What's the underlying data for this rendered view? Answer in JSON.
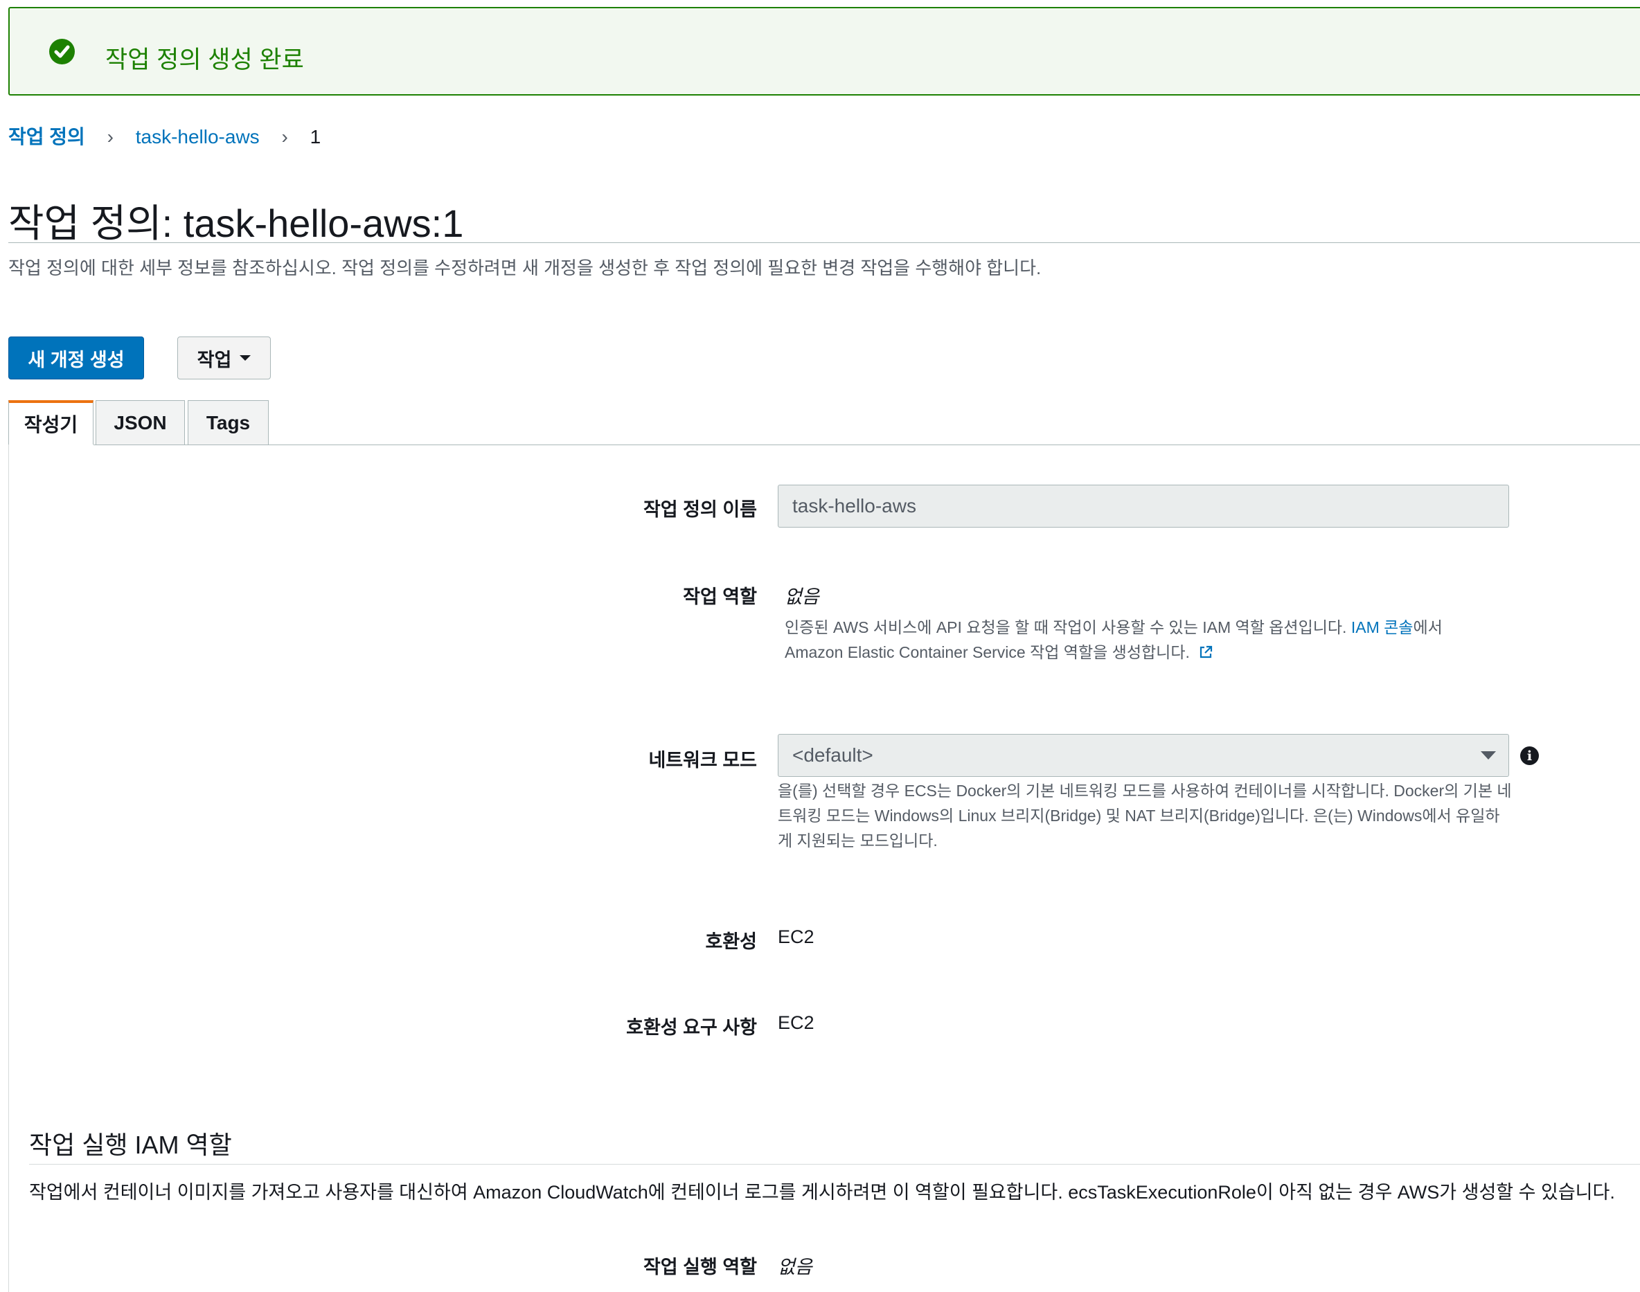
{
  "flash": {
    "message": "작업 정의 생성 완료"
  },
  "breadcrumb": {
    "items": [
      "작업 정의",
      "task-hello-aws",
      "1"
    ]
  },
  "page": {
    "title": "작업 정의: task-hello-aws:1",
    "description": "작업 정의에 대한 세부 정보를 참조하십시오. 작업 정의를 수정하려면 새 개정을 생성한 후 작업 정의에 필요한 변경 작업을 수행해야 합니다."
  },
  "buttons": {
    "create_revision": "새 개정 생성",
    "actions": "작업"
  },
  "tabs": [
    {
      "label": "작성기",
      "active": true
    },
    {
      "label": "JSON",
      "active": false
    },
    {
      "label": "Tags",
      "active": false
    }
  ],
  "fields": {
    "task_def_name": {
      "label": "작업 정의 이름",
      "value": "task-hello-aws"
    },
    "task_role": {
      "label": "작업 역할",
      "value": "없음",
      "help_prefix": "인증된 AWS 서비스에 API 요청을 할 때 작업이 사용할 수 있는 IAM 역할 옵션입니다.",
      "help_link": "IAM 콘솔",
      "help_suffix": "에서",
      "help_line2": "Amazon Elastic Container Service 작업 역할을 생성합니다."
    },
    "network_mode": {
      "label": "네트워크 모드",
      "value": "<default>",
      "help_line1": "을(를) 선택할 경우 ECS는 Docker의 기본 네트워킹 모드를 사용하여 컨테이너를 시작합니다. Docker의 기본 네",
      "help_line2": "트워킹 모드는 Windows의 Linux 브리지(Bridge) 및 NAT 브리지(Bridge)입니다. 은(는) Windows에서 유일하",
      "help_line3": "게 지원되는 모드입니다."
    },
    "compatibility": {
      "label": "호환성",
      "value": "EC2"
    },
    "requires_compatibility": {
      "label": "호환성 요구 사항",
      "value": "EC2"
    }
  },
  "execution_section": {
    "title": "작업 실행 IAM 역할",
    "description": "작업에서 컨테이너 이미지를 가져오고 사용자를 대신하여 Amazon CloudWatch에 컨테이너 로그를 게시하려면 이 역할이 필요합니다. ecsTaskExecutionRole이 아직 없는 경우 AWS가 생성할 수 있습니다.",
    "role": {
      "label": "작업 실행 역할",
      "value": "없음"
    }
  },
  "colors": {
    "success": "#1d8102",
    "link": "#0073bb",
    "primary": "#0073bb",
    "tab_accent": "#ec7211"
  }
}
